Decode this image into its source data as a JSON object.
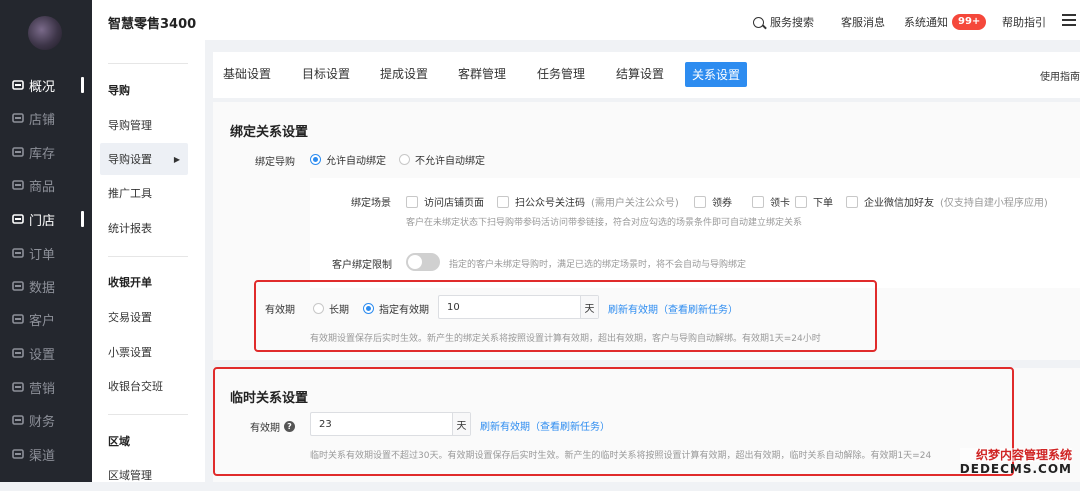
{
  "nav": {
    "items": [
      {
        "label": "概况",
        "icon": "overview-icon",
        "active": true
      },
      {
        "label": "店铺",
        "icon": "shop-icon"
      },
      {
        "label": "库存",
        "icon": "inventory-icon"
      },
      {
        "label": "商品",
        "icon": "goods-icon"
      },
      {
        "label": "门店",
        "icon": "store-icon",
        "active": true
      },
      {
        "label": "订单",
        "icon": "order-icon"
      },
      {
        "label": "数据",
        "icon": "data-icon"
      },
      {
        "label": "客户",
        "icon": "customer-icon"
      },
      {
        "label": "设置",
        "icon": "settings-icon"
      },
      {
        "label": "营销",
        "icon": "marketing-icon"
      },
      {
        "label": "财务",
        "icon": "finance-icon"
      },
      {
        "label": "渠道",
        "icon": "channel-icon"
      }
    ]
  },
  "sub_nav": {
    "brand": "智慧零售3400",
    "items": [
      {
        "label": "导购",
        "group": true
      },
      {
        "label": "导购管理"
      },
      {
        "label": "导购设置",
        "active": true
      },
      {
        "label": "推广工具"
      },
      {
        "label": "统计报表"
      },
      {
        "label": "收银开单",
        "group": true
      },
      {
        "label": "交易设置"
      },
      {
        "label": "小票设置"
      },
      {
        "label": "收银台交班"
      },
      {
        "label": "区域",
        "group": true
      },
      {
        "label": "区域管理"
      }
    ]
  },
  "header": {
    "search_label": "服务搜索",
    "service_msg": "客服消息",
    "sys_notice": "系统通知",
    "notice_badge": "99+",
    "help": "帮助指引"
  },
  "tabs": [
    "基础设置",
    "目标设置",
    "提成设置",
    "客群管理",
    "任务管理",
    "结算设置",
    "关系设置"
  ],
  "active_tab": "关系设置",
  "guide_link": "使用指南",
  "bind": {
    "title": "绑定关系设置",
    "guide_label": "绑定导购",
    "opt_allow": "允许自动绑定",
    "opt_deny": "不允许自动绑定",
    "scene_label": "绑定场景",
    "scenes": [
      {
        "label": "访问店铺页面",
        "note": ""
      },
      {
        "label": "扫公众号关注码",
        "note": "(需用户关注公众号)"
      },
      {
        "label": "领券",
        "note": ""
      },
      {
        "label": "领卡",
        "note": ""
      },
      {
        "label": "下单",
        "note": ""
      },
      {
        "label": "企业微信加好友",
        "note": "(仅支持自建小程序应用)"
      }
    ],
    "scene_hint": "客户在未绑定状态下扫导购带参码活访问带参链接，符合对应勾选的场景条件即可自动建立绑定关系",
    "limit_label": "客户绑定限制",
    "limit_hint": "指定的客户未绑定导购时，满足已选的绑定场景时，将不会自动与导购绑定",
    "validity_label": "有效期",
    "opt_long": "长期",
    "opt_specified": "指定有效期",
    "days_value": "10",
    "unit": "天",
    "refresh_link": "刷新有效期（查看刷新任务）",
    "validity_hint": "有效期设置保存后实时生效。新产生的绑定关系将按照设置计算有效期，超出有效期，客户与导购自动解绑。有效期1天=24小时"
  },
  "temp": {
    "title": "临时关系设置",
    "validity_label": "有效期",
    "days_value": "23",
    "unit": "天",
    "refresh_link": "刷新有效期（查看刷新任务）",
    "hint": "临时关系有效期设置不超过30天。有效期设置保存后实时生效。新产生的临时关系将按照设置计算有效期，超出有效期，临时关系自动解除。有效期1天=24"
  },
  "watermark": {
    "line1": "织梦内容管理系统",
    "line2": "DEDECMS.COM"
  }
}
